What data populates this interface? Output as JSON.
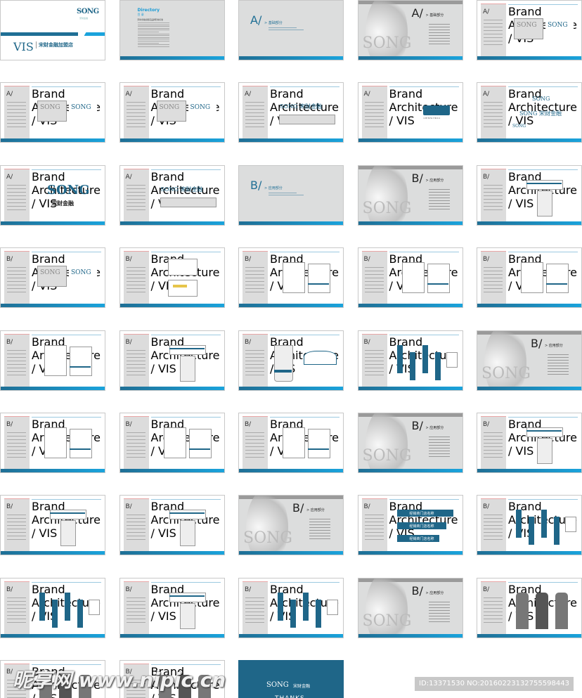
{
  "header_text": "Brand Architecture / VIS",
  "colors": {
    "brand_blue": "#1f6688",
    "accent_blue": "#1aa3dc",
    "page_gray": "#dcdddd",
    "thanks_bg": "#1f6688"
  },
  "pages": [
    {
      "type": "cover",
      "title": "VIS",
      "subtitle": "宋财金融加盟店",
      "logo": "SONG",
      "logo_sub": "宋财金融"
    },
    {
      "type": "directory",
      "title": "Directory",
      "subtitle": "目 录",
      "heading": "宋财金融加盟店品牌形象标准"
    },
    {
      "type": "section",
      "letter": "A/",
      "label": "> 基础部分"
    },
    {
      "type": "hero",
      "letter": "A/",
      "label": "> 基础部分",
      "mark": "SONG"
    },
    {
      "type": "content",
      "letter": "A/",
      "art": "logo-pair"
    },
    {
      "type": "content",
      "letter": "A/",
      "art": "logo-pair"
    },
    {
      "type": "content",
      "letter": "A/",
      "art": "logo-pair"
    },
    {
      "type": "content",
      "letter": "A/",
      "art": "wordmark",
      "logo": "SONG",
      "name": "宋财金融"
    },
    {
      "type": "content",
      "letter": "A/",
      "art": "color"
    },
    {
      "type": "content",
      "letter": "A/",
      "art": "stack",
      "logo": "SONG",
      "name": "宋财金融"
    },
    {
      "type": "content",
      "letter": "A/",
      "art": "big",
      "logo": "SONG",
      "name": "宋财金融"
    },
    {
      "type": "content",
      "letter": "A/",
      "art": "wordmark",
      "logo": "SONG",
      "name": "宋财金融"
    },
    {
      "type": "section",
      "letter": "B/",
      "label": "> 应用部分"
    },
    {
      "type": "hero",
      "letter": "B/",
      "label": "> 应用部分",
      "mark": "SONG"
    },
    {
      "type": "content",
      "letter": "B/",
      "art": "sign"
    },
    {
      "type": "content",
      "letter": "B/",
      "art": "logo-pair"
    },
    {
      "type": "content",
      "letter": "B/",
      "art": "card"
    },
    {
      "type": "content",
      "letter": "B/",
      "art": "stationery"
    },
    {
      "type": "content",
      "letter": "B/",
      "art": "stationery"
    },
    {
      "type": "content",
      "letter": "B/",
      "art": "stationery"
    },
    {
      "type": "content",
      "letter": "B/",
      "art": "stationery"
    },
    {
      "type": "content",
      "letter": "B/",
      "art": "sign"
    },
    {
      "type": "content",
      "letter": "B/",
      "art": "cup"
    },
    {
      "type": "content",
      "letter": "B/",
      "art": "bags"
    },
    {
      "type": "hero",
      "letter": "B/",
      "label": "> 应用部分",
      "mark": "SONG"
    },
    {
      "type": "content",
      "letter": "B/",
      "art": "stationery"
    },
    {
      "type": "content",
      "letter": "B/",
      "art": "stationery"
    },
    {
      "type": "content",
      "letter": "B/",
      "art": "stationery"
    },
    {
      "type": "hero",
      "letter": "B/",
      "label": "> 应用部分",
      "mark": "SONG"
    },
    {
      "type": "content",
      "letter": "B/",
      "art": "sign"
    },
    {
      "type": "content",
      "letter": "B/",
      "art": "sign"
    },
    {
      "type": "content",
      "letter": "B/",
      "art": "sign"
    },
    {
      "type": "hero",
      "letter": "B/",
      "label": "> 应用部分",
      "mark": "SONG"
    },
    {
      "type": "content",
      "letter": "B/",
      "art": "banners",
      "banner": "经销商门店名称"
    },
    {
      "type": "content",
      "letter": "B/",
      "art": "bags"
    },
    {
      "type": "content",
      "letter": "B/",
      "art": "bags"
    },
    {
      "type": "content",
      "letter": "B/",
      "art": "sign"
    },
    {
      "type": "content",
      "letter": "B/",
      "art": "bags"
    },
    {
      "type": "hero",
      "letter": "B/",
      "label": "> 应用部分",
      "mark": "SONG"
    },
    {
      "type": "content",
      "letter": "B/",
      "art": "uniform"
    },
    {
      "type": "content",
      "letter": "B/",
      "art": "uniform"
    },
    {
      "type": "content",
      "letter": "B/",
      "art": "uniform"
    },
    {
      "type": "thanks",
      "logo": "SONG",
      "name": "宋财金融",
      "text": "THANKS"
    }
  ],
  "watermark_id": "ID:13371530 NO:20160223132755598443",
  "watermark_site": "昵享网 www.nipic.cn"
}
